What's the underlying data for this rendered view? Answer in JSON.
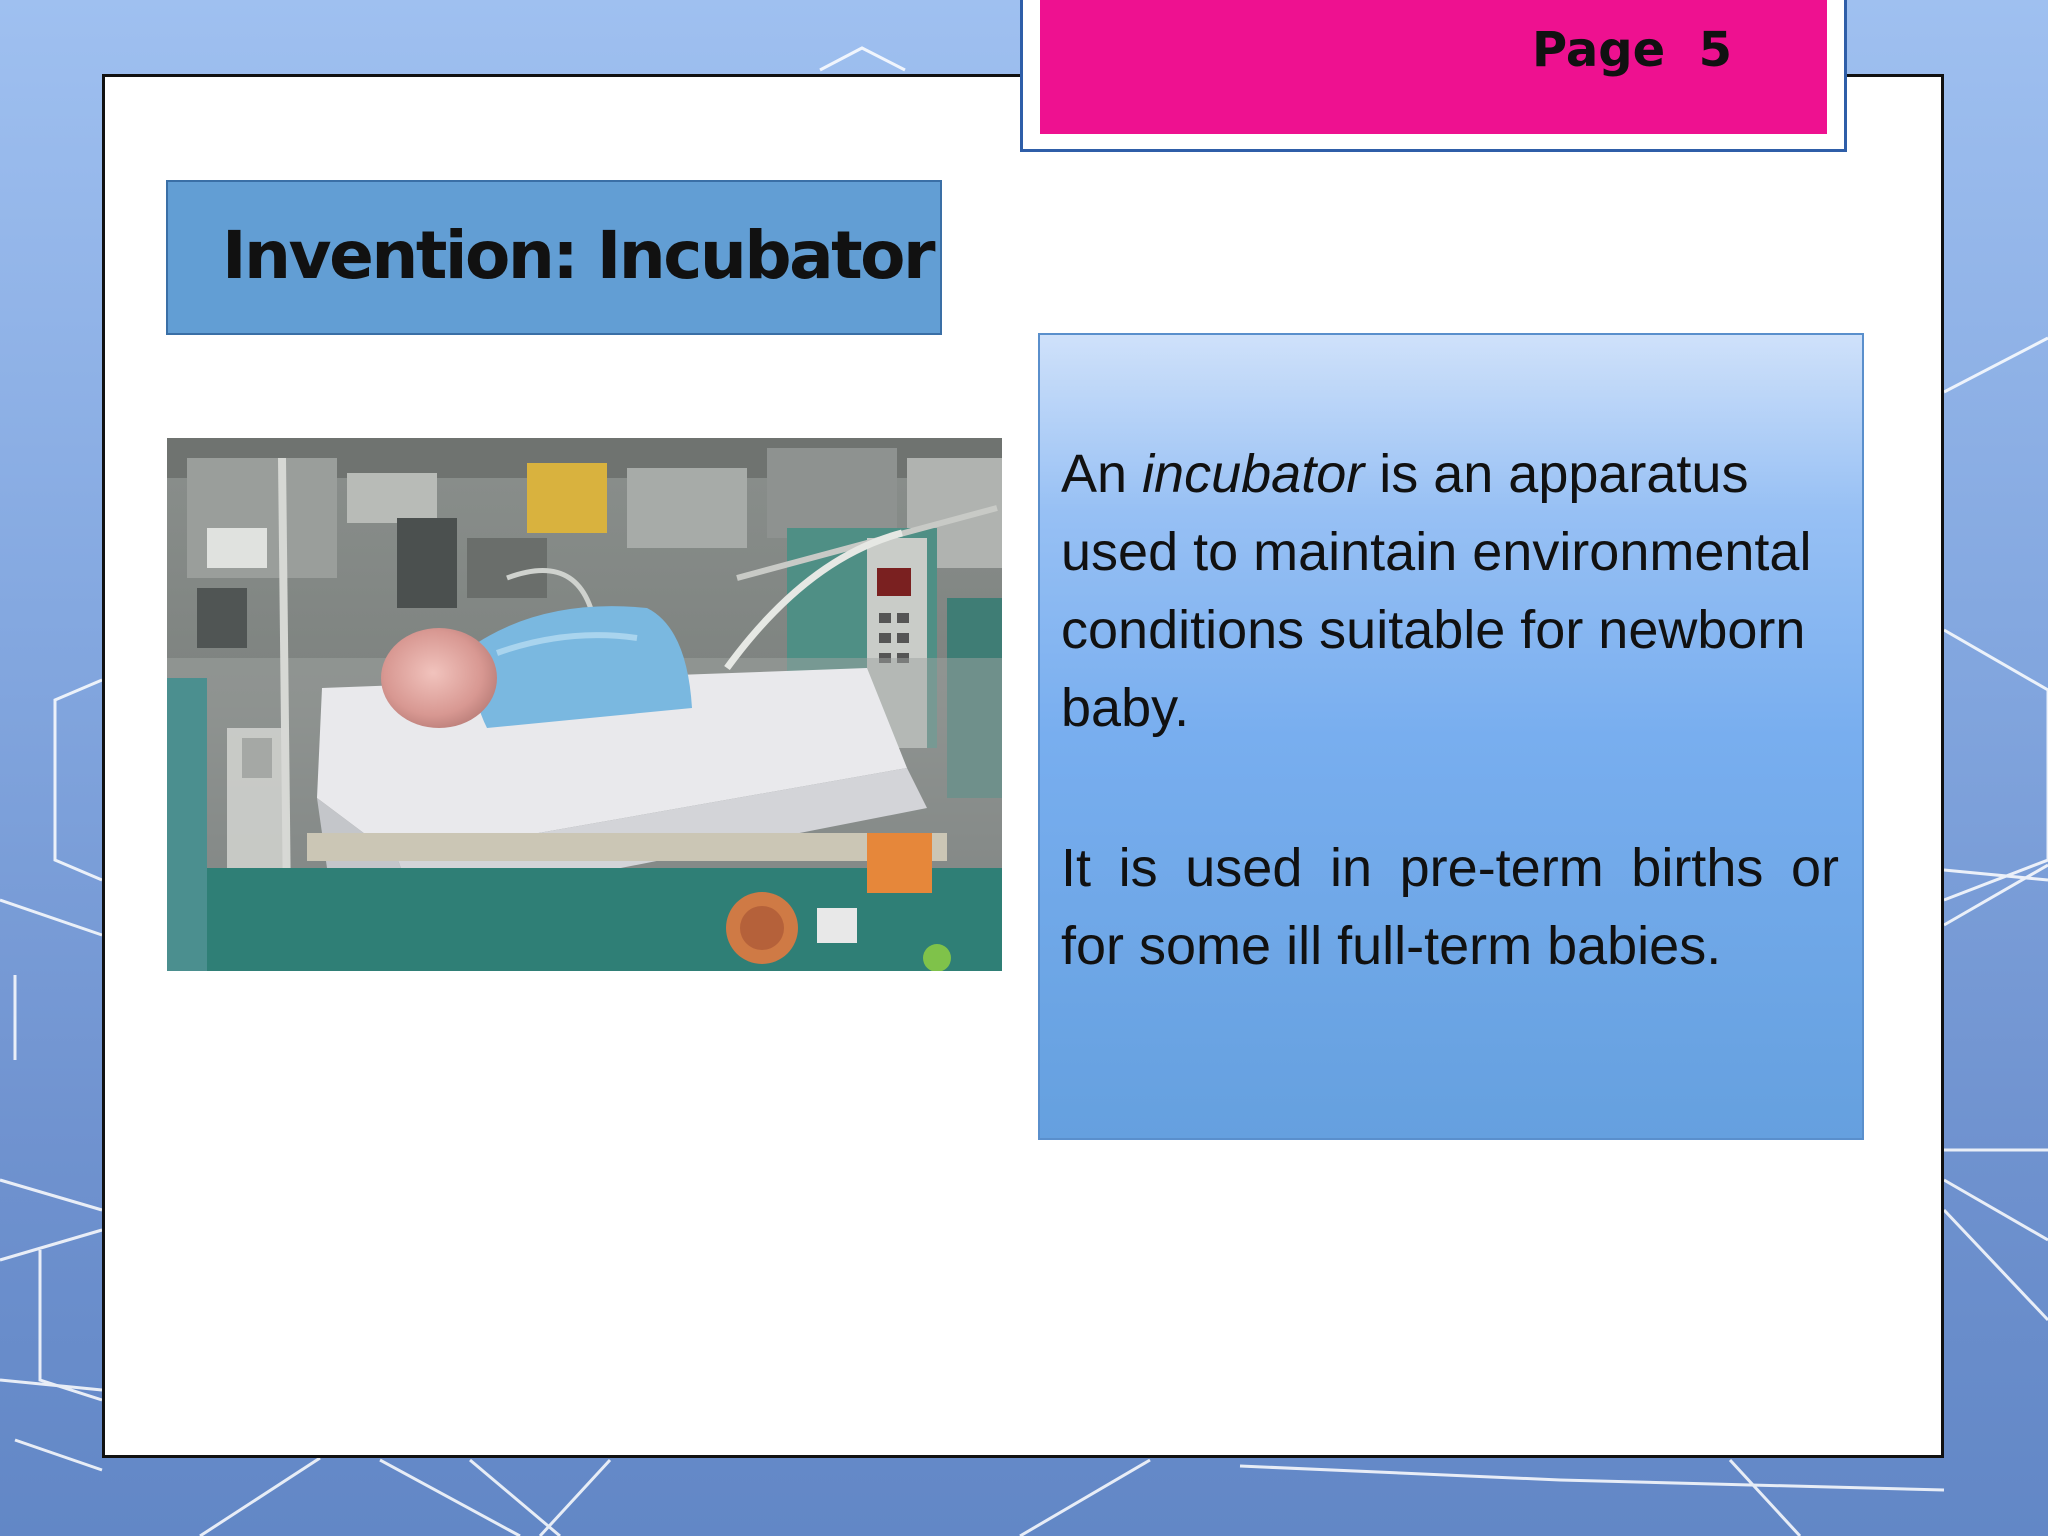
{
  "page": {
    "label": "Page  5"
  },
  "title": {
    "text": "Invention: Incubator"
  },
  "image": {
    "subject": "newborn baby in incubator photo"
  },
  "description": {
    "p1_prefix": "An ",
    "p1_term": "incubator",
    "p1_rest": " is an apparatus used to maintain environmental conditions suitable for newborn baby.",
    "p2": "It is used in pre-term births or for some ill full-term babies."
  },
  "colors": {
    "accent_pink": "#ee1190",
    "title_box_blue": "#629ed4",
    "background_blue": "#84a8e0"
  }
}
